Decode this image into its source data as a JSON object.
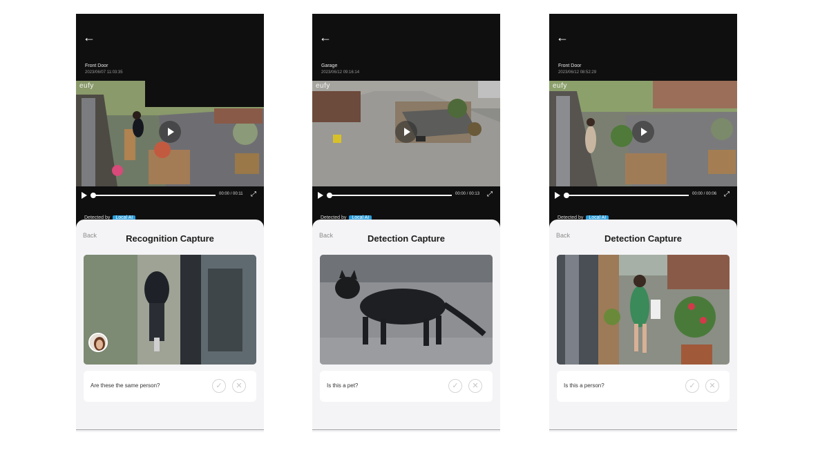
{
  "screens": [
    {
      "camera_name": "Front Door",
      "timestamp": "2023/06/07 11:03:35",
      "logo": "eufy",
      "duration": "00:00 / 00:11",
      "detected_by": "Detected by",
      "detected_badge": "Local AI",
      "back_label": "Back",
      "title": "Recognition Capture",
      "question": "Are these the same person?",
      "confirm_icon": "✓",
      "reject_icon": "✕"
    },
    {
      "camera_name": "Garage",
      "timestamp": "2023/06/12 09:16:14",
      "logo": "eufy",
      "duration": "00:00 / 00:13",
      "detected_by": "Detected by",
      "detected_badge": "Local AI",
      "back_label": "Back",
      "title": "Detection Capture",
      "question": "Is this a pet?",
      "confirm_icon": "✓",
      "reject_icon": "✕"
    },
    {
      "camera_name": "Front Door",
      "timestamp": "2023/06/12 08:52:29",
      "logo": "eufy",
      "duration": "00:00 / 00:06",
      "detected_by": "Detected by",
      "detected_badge": "Local AI",
      "back_label": "Back",
      "title": "Detection Capture",
      "question": "Is this a person?",
      "confirm_icon": "✓",
      "reject_icon": "✕"
    }
  ],
  "icons": {
    "back_arrow": "←",
    "fullscreen": "⤢",
    "nav_back": "◀"
  },
  "colors": {
    "app_background": "#0f0f10",
    "sheet_background": "#f4f4f6",
    "local_ai_badge": "#2b9cd8"
  }
}
